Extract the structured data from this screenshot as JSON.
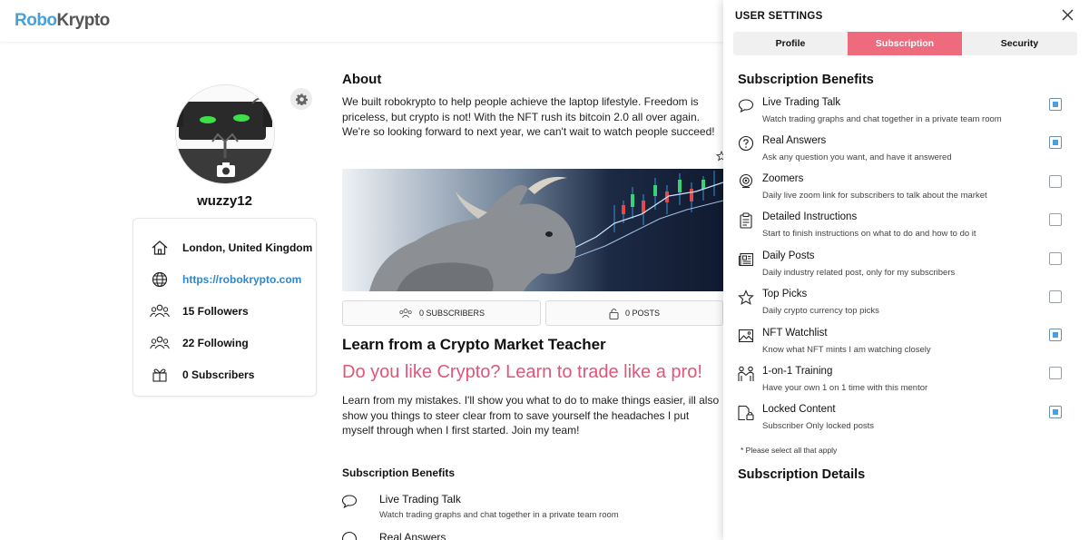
{
  "brand": {
    "part1": "Robo",
    "part2": "Krypto"
  },
  "profile": {
    "username": "wuzzy12",
    "location": "London, United Kingdom",
    "website": "https://robokrypto.com",
    "followers": "15 Followers",
    "following": "22 Following",
    "subscribers": "0 Subscribers"
  },
  "about": {
    "title": "About",
    "text": "We built robokrypto to help people achieve the laptop lifestyle. Freedom is priceless, but crypto is not! With the NFT rush its bitcoin 2.0 all over again. We're so looking forward to next year, we can't wait to watch people succeed!"
  },
  "stats": {
    "subscribers": "0 SUBSCRIBERS",
    "posts": "0 POSTS"
  },
  "main": {
    "title": "Learn from a Crypto Market Teacher",
    "tagline": "Do you like Crypto? Learn to trade like a pro!",
    "text": "Learn from my mistakes. I'll show you what to do to make things easier, ill also show you things to steer clear from to save yourself the headaches I put myself through when I first started. Join my team!",
    "benefits_heading": "Subscription Benefits",
    "benefits": [
      {
        "title": "Live Trading Talk",
        "desc": "Watch trading graphs and chat together in a private team room"
      },
      {
        "title": "Real Answers",
        "desc": ""
      }
    ]
  },
  "panel": {
    "title": "USER SETTINGS",
    "tabs": [
      {
        "label": "Profile",
        "active": false
      },
      {
        "label": "Subscription",
        "active": true
      },
      {
        "label": "Security",
        "active": false
      }
    ],
    "benefits_heading": "Subscription Benefits",
    "benefits": [
      {
        "icon": "chat-bubble-icon",
        "title": "Live Trading Talk",
        "desc": "Watch trading graphs and chat together in a private team room",
        "checked": true
      },
      {
        "icon": "question-icon",
        "title": "Real Answers",
        "desc": "Ask any question you want, and have it answered",
        "checked": true
      },
      {
        "icon": "webcam-icon",
        "title": "Zoomers",
        "desc": "Daily live zoom link for subscribers to talk about the market",
        "checked": false
      },
      {
        "icon": "clipboard-icon",
        "title": "Detailed Instructions",
        "desc": "Start to finish instructions on what to do and how to do it",
        "checked": false
      },
      {
        "icon": "newspaper-icon",
        "title": "Daily Posts",
        "desc": "Daily industry related post, only for my subscribers",
        "checked": false
      },
      {
        "icon": "star-icon",
        "title": "Top Picks",
        "desc": "Daily crypto currency top picks",
        "checked": false
      },
      {
        "icon": "image-icon",
        "title": "NFT Watchlist",
        "desc": "Know what NFT mints I am watching closely",
        "checked": true
      },
      {
        "icon": "training-icon",
        "title": "1-on-1 Training",
        "desc": "Have your own 1 on 1 time with this mentor",
        "checked": false
      },
      {
        "icon": "lock-file-icon",
        "title": "Locked Content",
        "desc": "Subscriber Only locked posts",
        "checked": true
      }
    ],
    "note": "* Please select all that apply",
    "details_heading": "Subscription Details"
  },
  "colors": {
    "accent_pink": "#ee6b7d",
    "link_blue": "#2f86c9",
    "checkbox_fill": "#4aa0d8"
  }
}
